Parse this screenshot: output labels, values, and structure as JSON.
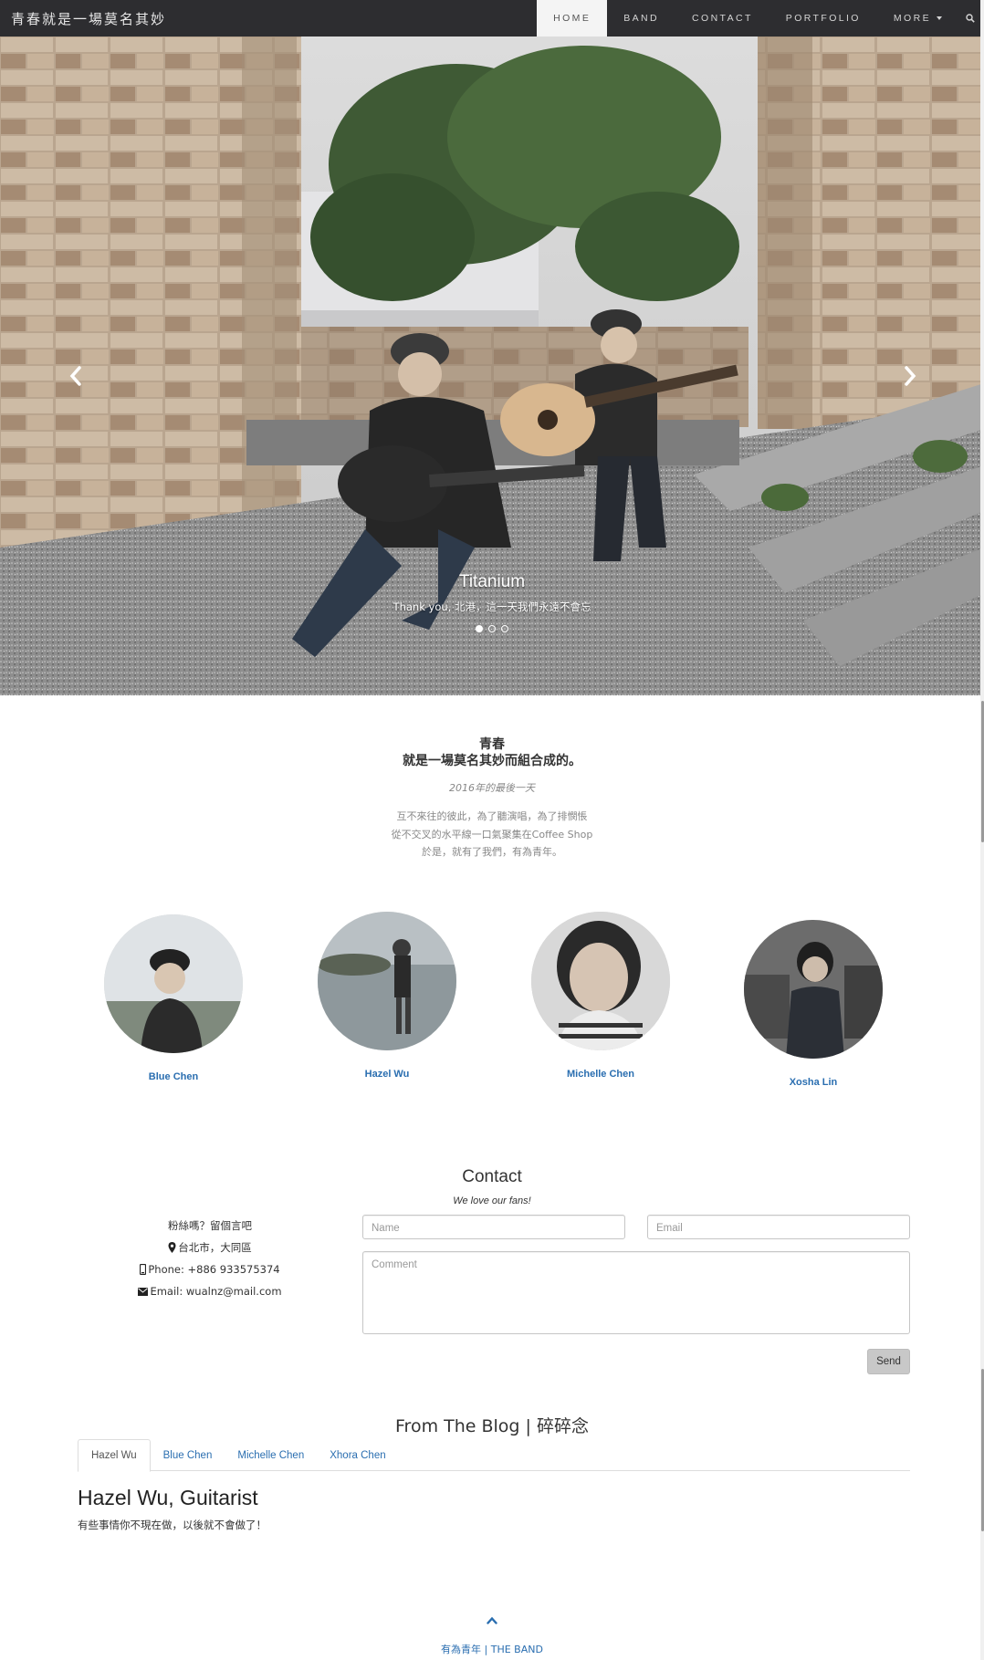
{
  "brand": "青春就是一場莫名其妙",
  "nav": {
    "items": [
      "HOME",
      "BAND",
      "CONTACT",
      "PORTFOLIO"
    ],
    "more": "MORE",
    "active_index": 0
  },
  "hero": {
    "caption_title": "Titanium",
    "caption_sub": "Thank you, 北港，這一天我們永遠不會忘",
    "slide_count": 3,
    "active_slide": 0
  },
  "intro": {
    "line1": "青春",
    "line2": "就是一場莫名其妙而組合成的。",
    "date": "2016年的最後一天",
    "p1": "互不來往的彼此，為了聽演唱，為了排憫悵",
    "p2": "從不交叉的水平線一口氣聚集在Coffee Shop",
    "p3": "於是，就有了我們，有為青年。"
  },
  "members": [
    {
      "name": "Blue Chen"
    },
    {
      "name": "Hazel Wu"
    },
    {
      "name": "Michelle Chen"
    },
    {
      "name": "Xosha Lin"
    }
  ],
  "contact": {
    "title": "Contact",
    "subtitle": "We love our fans!",
    "info_intro": "粉絲嗎？留個言吧",
    "location": "台北市，大同區",
    "phone": "Phone: +886 933575374",
    "email": "Email: wualnz@mail.com",
    "name_placeholder": "Name",
    "email_placeholder": "Email",
    "comment_placeholder": "Comment",
    "send_label": "Send"
  },
  "blog": {
    "title": "From The Blog | 碎碎念",
    "tabs": [
      "Hazel Wu",
      "Blue Chen",
      "Michelle Chen",
      "Xhora Chen"
    ],
    "active_tab": 0,
    "heading": "Hazel Wu, Guitarist",
    "text": "有些事情你不現在做，以後就不會做了！"
  },
  "footer": {
    "text": "有為青年 | THE BAND"
  },
  "colors": {
    "navbar": "#2d2d30",
    "link": "#2a6eb0",
    "send_button": "#c8c8c8"
  }
}
